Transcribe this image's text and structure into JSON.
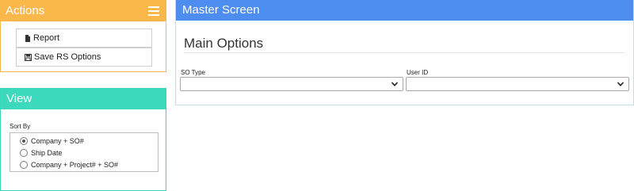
{
  "actions": {
    "title": "Actions",
    "buttons": [
      {
        "label": "Report",
        "icon": "document-icon"
      },
      {
        "label": "Save RS Options",
        "icon": "save-icon"
      }
    ]
  },
  "view": {
    "title": "View",
    "sort_by_label": "Sort By",
    "options": [
      {
        "label": "Company + SO#",
        "checked": true
      },
      {
        "label": "Ship Date",
        "checked": false
      },
      {
        "label": "Company + Project# + SO#",
        "checked": false
      }
    ]
  },
  "master": {
    "title": "Master Screen",
    "section_title": "Main Options",
    "fields": [
      {
        "label": "SO Type",
        "value": ""
      },
      {
        "label": "User ID",
        "value": ""
      }
    ]
  },
  "colors": {
    "actions_header": "#fbb84a",
    "view_header": "#3dd9bd",
    "master_header": "#4e8df0"
  }
}
